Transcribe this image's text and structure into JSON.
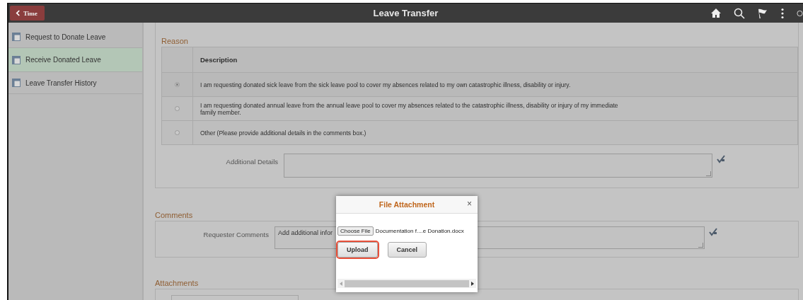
{
  "header": {
    "back_button": "Time",
    "title": "Leave Transfer"
  },
  "sidebar": {
    "items": [
      {
        "label": "Request to Donate Leave",
        "selected": false
      },
      {
        "label": "Receive Donated Leave",
        "selected": true
      },
      {
        "label": "Leave Transfer History",
        "selected": false
      }
    ]
  },
  "reason": {
    "title": "Reason",
    "column": "Description",
    "rows": [
      {
        "text": "I am requesting donated sick leave from the sick leave pool to cover my absences related to my own catastrophic illness, disability or injury.",
        "selected": true
      },
      {
        "text": "I am requesting donated annual leave from the annual leave pool to cover my absences related to the catastrophic illness, disability or injury of my immediate family member.",
        "selected": false
      },
      {
        "text": "Other (Please provide additional details in the comments box.)",
        "selected": false
      }
    ],
    "details_label": "Additional Details"
  },
  "comments": {
    "title": "Comments",
    "label": "Requester Comments",
    "value": "Add additional infor"
  },
  "attachments": {
    "title": "Attachments"
  },
  "dialog": {
    "title": "File Attachment",
    "close": "×",
    "choose_button": "Choose File",
    "file_name": "Documentation f....e Donation.docx",
    "buttons": [
      {
        "label": "Upload",
        "highlighted": true
      },
      {
        "label": "Cancel",
        "highlighted": false
      }
    ]
  }
}
